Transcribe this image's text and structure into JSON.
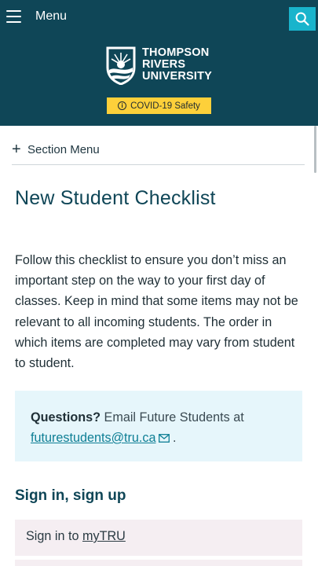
{
  "header": {
    "menu_label": "Menu",
    "logo_lines": [
      "THOMPSON",
      "RIVERS",
      "UNIVERSITY"
    ],
    "covid_label": "COVID-19 Safety",
    "colors": {
      "background": "#0f4657",
      "search": "#19b4cc",
      "covid": "#fdd03a"
    }
  },
  "section_menu": {
    "label": "Section Menu"
  },
  "main": {
    "title": "New Student Checklist",
    "intro": "Follow this checklist to ensure you don’t miss an important step on the way to your first day of classes. Keep in mind that some items may not be relevant to all incoming students. The order in which items are completed may vary from student to student.",
    "callout": {
      "strong": "Questions?",
      "text": " Email Future Students at",
      "email": "futurestudents@tru.ca",
      "end": "."
    },
    "section_heading": "Sign in, sign up",
    "items": [
      {
        "prefix": "Sign in to ",
        "link": "myTRU"
      }
    ]
  }
}
